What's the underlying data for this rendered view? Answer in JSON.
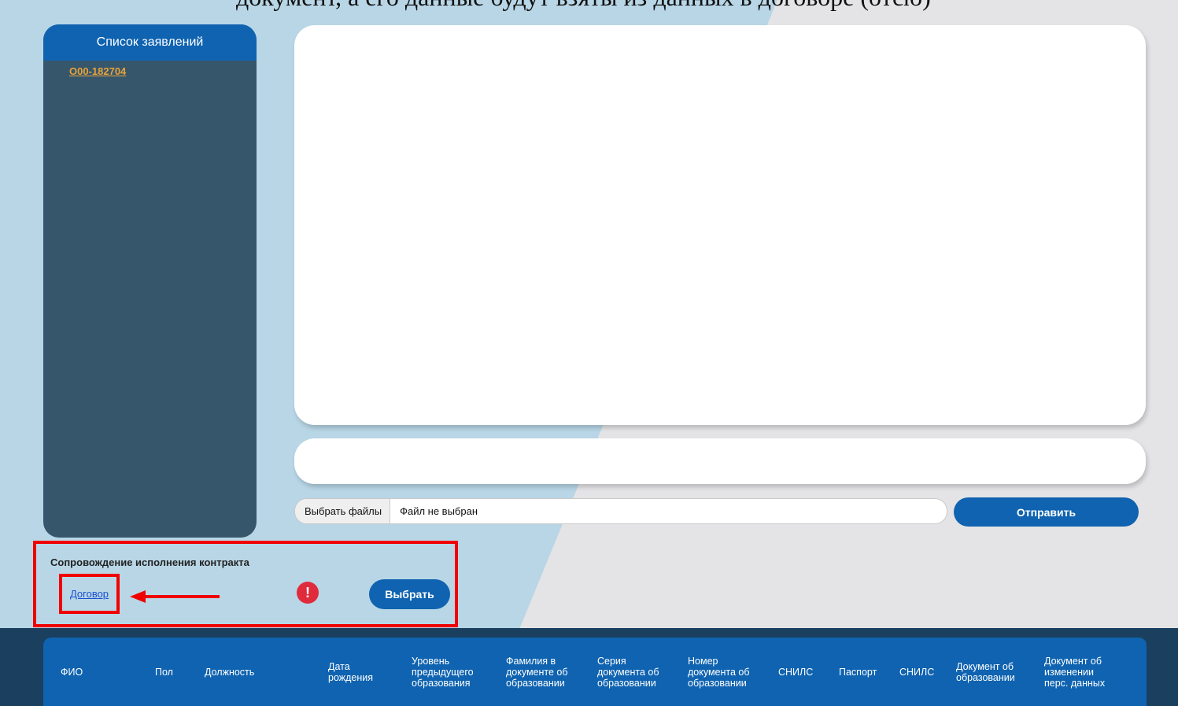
{
  "top_partial_text": "документ, а его данные будут взяты из данных в договоре (отсю)",
  "sidebar": {
    "title": "Список заявлений",
    "items": [
      {
        "label": "О00-182704"
      }
    ]
  },
  "file_picker": {
    "button_label": "Выбрать файлы",
    "status": "Файл не выбран"
  },
  "send_button": {
    "label": "Отправить"
  },
  "contract_section": {
    "title": "Сопровождение исполнения контракта",
    "link_label": "Договор",
    "alert_glyph": "!",
    "select_button_label": "Выбрать"
  },
  "table": {
    "columns": [
      "ФИО",
      "Пол",
      "Должность",
      "Дата рождения",
      "Уровень предыдущего образования",
      "Фамилия в документе об образовании",
      "Серия документа об образовании",
      "Номер документа об образовании",
      "СНИЛС",
      "Паспорт",
      "СНИЛС",
      "Документ об образовании",
      "Документ об изменении перс. данных"
    ]
  },
  "colors": {
    "primary": "#0f63b0",
    "sidebar_bg": "#36566c",
    "accent_link": "#e8a33a",
    "highlight_red": "#f00000",
    "bg_light_blue": "#b8d6e6",
    "bg_grey": "#e4e4e6",
    "footer_dark": "#1b3f5e"
  }
}
